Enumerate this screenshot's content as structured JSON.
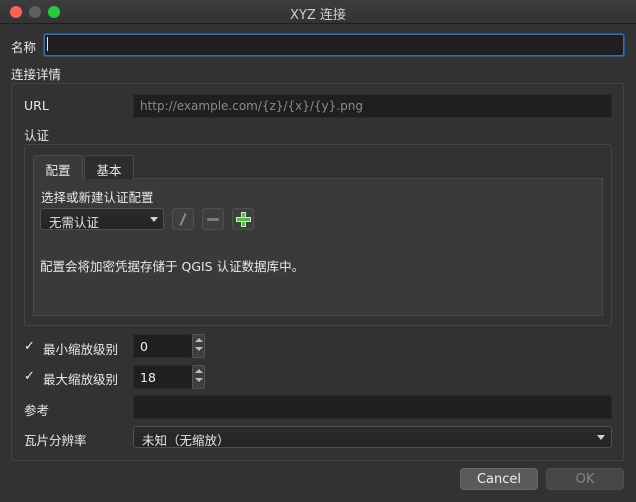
{
  "window": {
    "title": "XYZ 连接"
  },
  "name_field": {
    "label": "名称",
    "value": ""
  },
  "connection": {
    "section_label": "连接详情",
    "url": {
      "label": "URL",
      "placeholder": "http://example.com/{z}/{x}/{y}.png"
    },
    "auth": {
      "label": "认证",
      "tabs": [
        {
          "label": "配置",
          "active": true
        },
        {
          "label": "基本",
          "active": false
        }
      ],
      "config_label": "选择或新建认证配置",
      "config_selected": "无需认证",
      "info_text": "配置会将加密凭据存储于 QGIS 认证数据库中。"
    },
    "min_zoom": {
      "label": "最小缩放级别",
      "checked": true,
      "check_glyph": "✓",
      "value": "0"
    },
    "max_zoom": {
      "label": "最大缩放级别",
      "checked": true,
      "check_glyph": "✓",
      "value": "18"
    },
    "referer": {
      "label": "参考",
      "value": ""
    },
    "tile_resolution": {
      "label": "瓦片分辨率",
      "selected": "未知（无缩放）"
    }
  },
  "buttons": {
    "cancel": "Cancel",
    "ok": "OK"
  },
  "colors": {
    "focus": "#3b6ea8",
    "add_green": "#55b64a",
    "close_red": "#ff5f57",
    "zoom_green": "#28c840"
  }
}
